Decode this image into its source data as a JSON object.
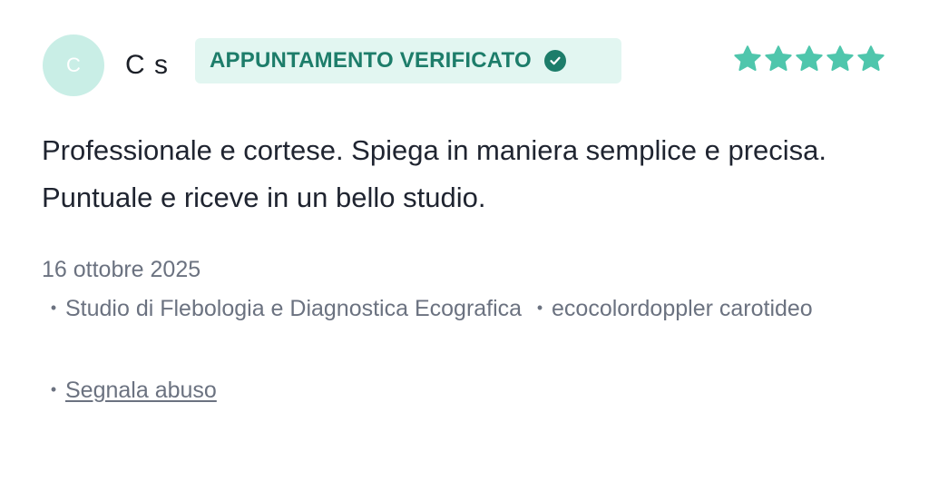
{
  "review": {
    "author_initial": "C",
    "author_name": "C s",
    "badge_label": "APPUNTAMENTO VERIFICATO",
    "rating": 5,
    "rating_max": 5,
    "text": "Professionale e cortese. Spiega in maniera semplice e precisa. Puntuale e riceve in un bello studio.",
    "date": "16 ottobre 2025",
    "facility": "Studio di Flebologia e Diagnostica Ecografica",
    "service": "ecocolordoppler carotideo",
    "report_label": "Segnala abuso"
  },
  "colors": {
    "accent": "#1d7d6a",
    "star": "#4fc6ac",
    "avatar_bg": "#c9eee6",
    "badge_bg": "#e2f6f1",
    "muted_text": "#6b7280"
  },
  "icons": {
    "badge": "check-circle-icon",
    "rating": "star-icon"
  }
}
